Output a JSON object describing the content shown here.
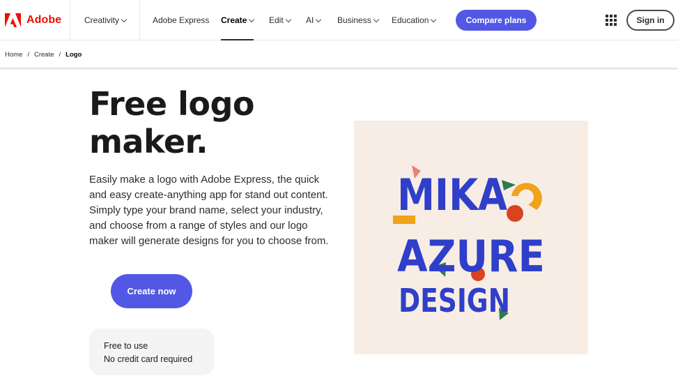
{
  "brand": {
    "name": "Adobe",
    "color": "#eb1000",
    "icon": "adobe-logo-icon"
  },
  "nav": {
    "items": [
      {
        "label": "Creativity",
        "has_dropdown": true
      },
      {
        "label": "Adobe Express",
        "has_dropdown": false
      },
      {
        "label": "Create",
        "has_dropdown": true,
        "active": true
      },
      {
        "label": "Edit",
        "has_dropdown": true
      },
      {
        "label": "AI",
        "has_dropdown": true
      },
      {
        "label": "Business",
        "has_dropdown": true
      },
      {
        "label": "Education",
        "has_dropdown": true
      }
    ],
    "compare_plans": "Compare plans",
    "apps_icon": "app-grid-icon",
    "sign_in": "Sign in"
  },
  "breadcrumb": {
    "items": [
      "Home",
      "Create",
      "Logo"
    ],
    "separator": "/"
  },
  "hero": {
    "title_line1": "Free logo",
    "title_line2": "maker.",
    "description": "Easily make a logo with Adobe Express, the quick and easy create-anything app for stand out content. Simply type your brand name, select your industry, and choose from a range of styles and our logo maker will generate designs for you to choose from.",
    "cta": "Create now",
    "free_line1": "Free to use",
    "free_line2": "No credit card required"
  },
  "logo_sample": {
    "line1": "MIKA",
    "line2": "AZURE",
    "line3": "DESIGN",
    "colors": {
      "background": "#f7ede4",
      "text": "#2f3fc9",
      "orange": "#f0a21a",
      "red": "#d9431e",
      "green": "#2f7a4f",
      "pink": "#e8827a"
    }
  },
  "colors": {
    "accent": "#5258e4",
    "nav_text": "#2c2c2c"
  }
}
